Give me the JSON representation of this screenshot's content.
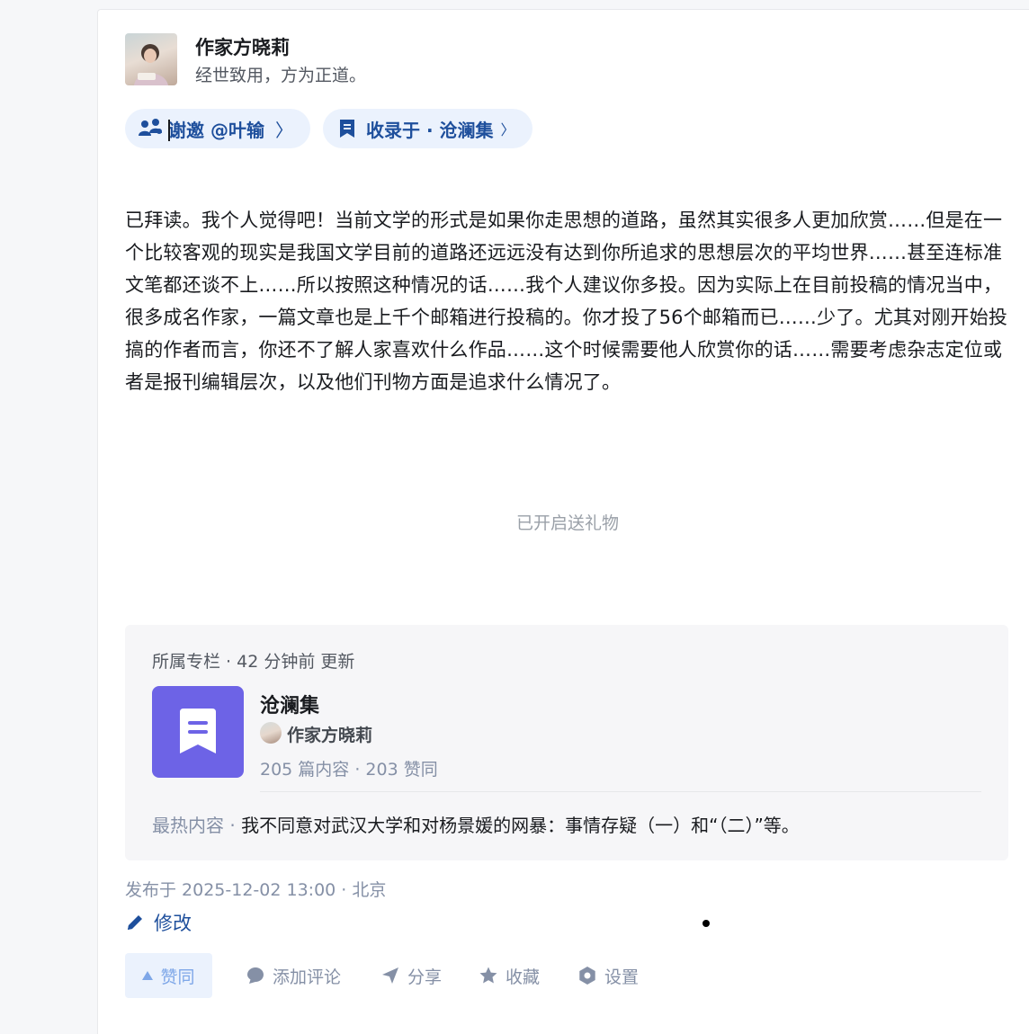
{
  "author": {
    "name": "作家方晓莉",
    "bio": "经世致用，方为正道。"
  },
  "invite": {
    "label": "谢邀 @叶输",
    "chevron": "〉"
  },
  "collection": {
    "label": "收录于 · 沧澜集",
    "chevron": "〉"
  },
  "article": {
    "body": "已拜读。我个人觉得吧！当前文学的形式是如果你走思想的道路，虽然其实很多人更加欣赏……但是在一个比较客观的现实是我国文学目前的道路还远远没有达到你所追求的思想层次的平均世界……甚至连标准文笔都还谈不上……所以按照这种情况的话……我个人建议你多投。因为实际上在目前投稿的情况当中，很多成名作家，一篇文章也是上千个邮箱进行投稿的。你才投了56个邮箱而已……少了。尤其对刚开始投搞的作者而言，你还不了解人家喜欢什么作品……这个时候需要他人欣赏你的话……需要考虑杂志定位或者是报刊编辑层次，以及他们刊物方面是追求什么情况了。",
    "gift_notice": "已开启送礼物"
  },
  "column": {
    "meta": "所属专栏 · 42 分钟前 更新",
    "name": "沧澜集",
    "author": "作家方晓莉",
    "stats": "205 篇内容 · 203 赞同",
    "hot_label": "最热内容 · ",
    "hot_text": "我不同意对武汉大学和对杨景媛的网暴：事情存疑（一）和“（二）”等。",
    "logo_color": "#6d63e6"
  },
  "publish_info": "发布于 2025-12-02 13:00 · 北京",
  "edit_label": "修改",
  "actions": {
    "vote": "赞同",
    "comment": "添加评论",
    "share": "分享",
    "favorite": "收藏",
    "settings": "设置"
  },
  "colors": {
    "accent": "#1e4f9c",
    "pill_bg": "#ebf2fd",
    "muted": "#8590a6"
  }
}
